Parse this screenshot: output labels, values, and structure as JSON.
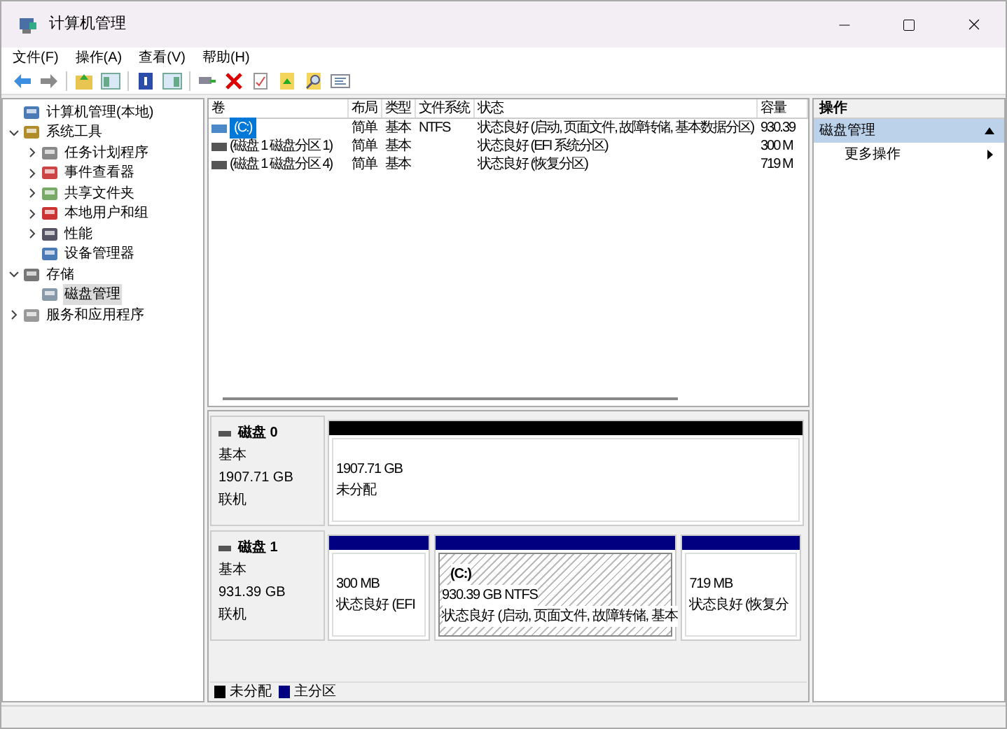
{
  "window": {
    "title": "计算机管理"
  },
  "menu": [
    "文件(F)",
    "操作(A)",
    "查看(V)",
    "帮助(H)"
  ],
  "tree": [
    {
      "label": "计算机管理(本地)",
      "selected": false,
      "children": [
        {
          "label": "系统工具",
          "expanded": true,
          "selected": false,
          "children": [
            {
              "label": "任务计划程序",
              "expanded": false,
              "selected": false
            },
            {
              "label": "事件查看器",
              "expanded": false,
              "selected": false
            },
            {
              "label": "共享文件夹",
              "expanded": false,
              "selected": false
            },
            {
              "label": "本地用户和组",
              "expanded": false,
              "selected": false
            },
            {
              "label": "性能",
              "expanded": false,
              "selected": false
            },
            {
              "label": "设备管理器",
              "selected": false
            }
          ]
        },
        {
          "label": "存储",
          "expanded": true,
          "selected": false,
          "children": [
            {
              "label": "磁盘管理",
              "selected": true
            }
          ]
        },
        {
          "label": "服务和应用程序",
          "expanded": false,
          "selected": false
        }
      ]
    }
  ],
  "table": {
    "columns": [
      "卷",
      "布局",
      "类型",
      "文件系统",
      "状态",
      "容量"
    ],
    "rows": [
      {
        "selected": true,
        "cells": [
          "(C:)",
          "简单",
          "基本",
          "NTFS",
          "状态良好 (启动, 页面文件, 故障转储, 基本数据分区)",
          "930.39"
        ]
      },
      {
        "selected": false,
        "cells": [
          "(磁盘 1 磁盘分区 1)",
          "简单",
          "基本",
          "",
          "状态良好 (EFI 系统分区)",
          "300 M"
        ]
      },
      {
        "selected": false,
        "cells": [
          "(磁盘 1 磁盘分区 4)",
          "简单",
          "基本",
          "",
          "状态良好 (恢复分区)",
          "719 M"
        ]
      }
    ]
  },
  "disks": [
    {
      "name": "磁盘 0",
      "type": "基本",
      "size": "1907.71 GB",
      "status": "联机",
      "partitions": [
        {
          "color": "#000000",
          "selected": false,
          "size": "1907.71 GB",
          "status": "未分配"
        }
      ]
    },
    {
      "name": "磁盘 1",
      "type": "基本",
      "size": "931.39 GB",
      "status": "联机",
      "partitions": [
        {
          "color": "#000080",
          "selected": false,
          "size": "300 MB",
          "status": "状态良好 (EFI"
        },
        {
          "color": "#000080",
          "selected": true,
          "label": "(C:)",
          "size": "930.39 GB NTFS",
          "status": "状态良好 (启动, 页面文件, 故障转储, 基本"
        },
        {
          "color": "#000080",
          "selected": false,
          "size": "719 MB",
          "status": "状态良好 (恢复分"
        }
      ]
    }
  ],
  "legend": [
    {
      "color": "#000000",
      "label": "未分配"
    },
    {
      "color": "#000080",
      "label": "主分区"
    }
  ],
  "actions": {
    "title": "操作",
    "sections": [
      {
        "label": "磁盘管理",
        "expanded": true,
        "items": [
          "更多操作"
        ]
      }
    ]
  }
}
